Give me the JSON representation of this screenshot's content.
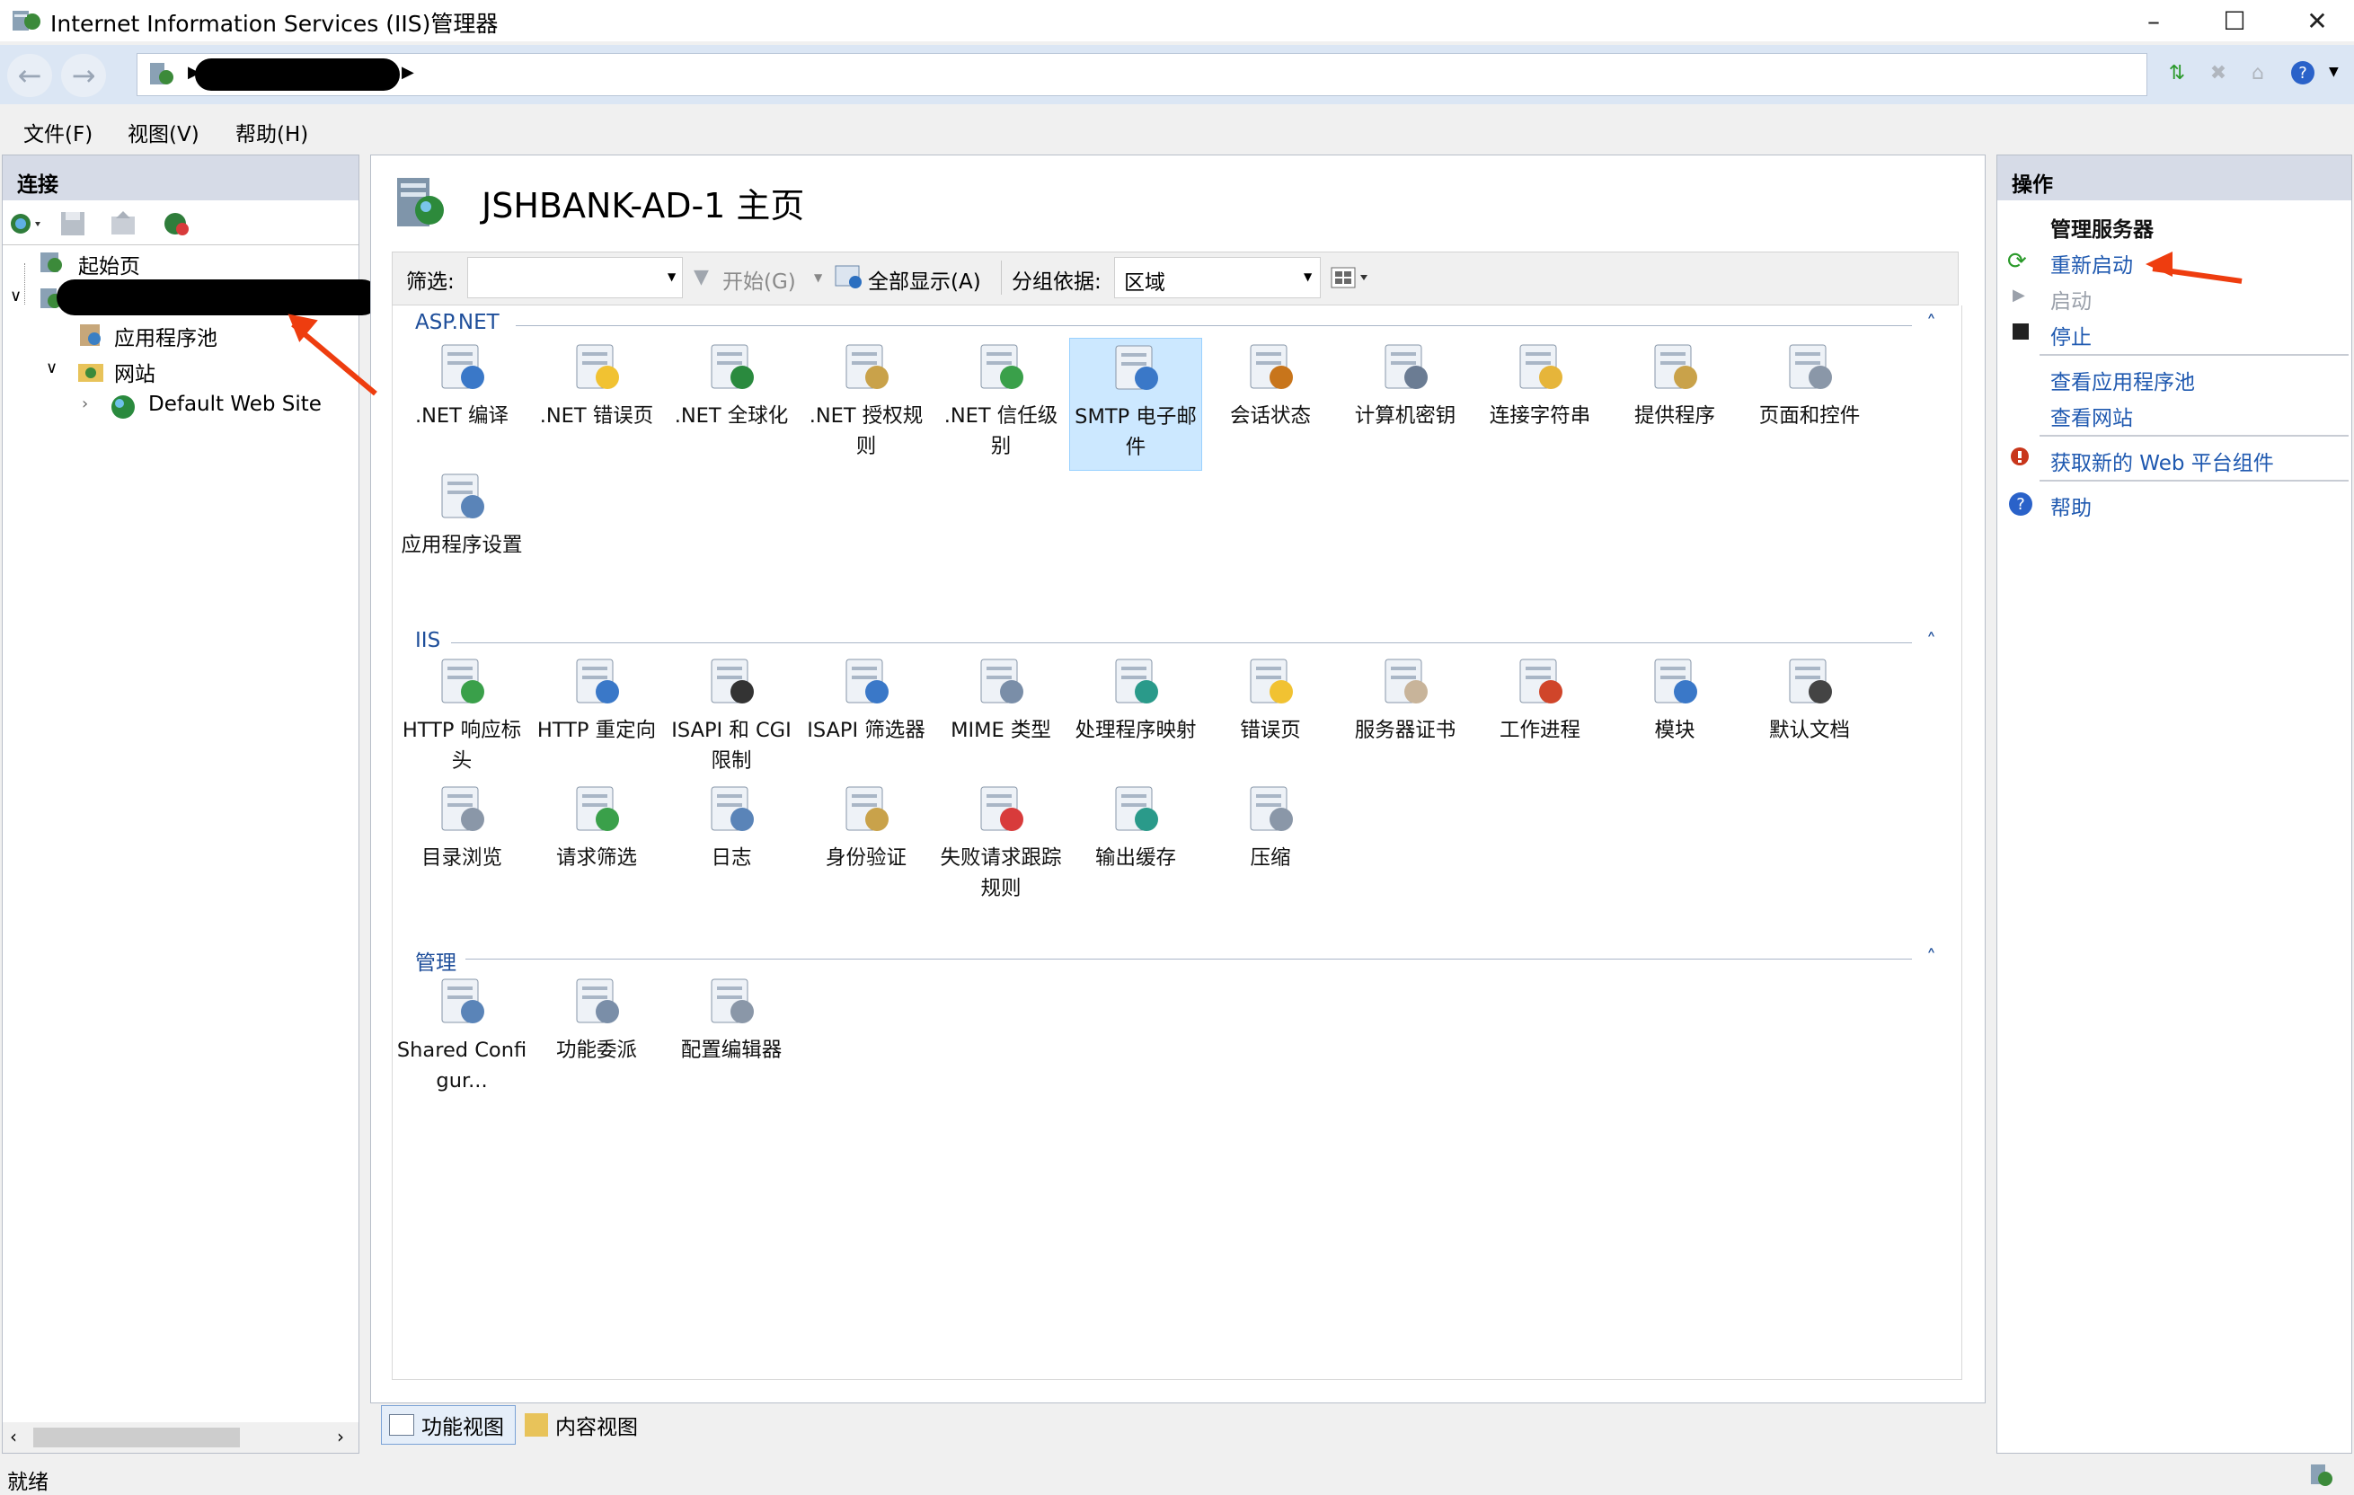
{
  "window": {
    "title": "Internet Information Services (IIS)管理器"
  },
  "menu": [
    "文件(F)",
    "视图(V)",
    "帮助(H)"
  ],
  "connections": {
    "title": "连接",
    "tree": {
      "start_page": "起始页",
      "app_pools": "应用程序池",
      "sites": "网站",
      "default_site": "Default Web Site"
    }
  },
  "main": {
    "page_title": "JSHBANK-AD-1 主页",
    "filter": {
      "label": "筛选:",
      "go": "开始(G)",
      "show_all": "全部显示(A)",
      "group_by_label": "分组依据:",
      "group_by_value": "区域"
    },
    "sections": [
      {
        "title": "ASP.NET",
        "items": [
          {
            "label": ".NET 编译",
            "icon": "net-compile-icon"
          },
          {
            "label": ".NET 错误页",
            "icon": "net-error-pages-icon"
          },
          {
            "label": ".NET 全球化",
            "icon": "net-globalization-icon"
          },
          {
            "label": ".NET 授权规则",
            "icon": "net-authorization-icon"
          },
          {
            "label": ".NET 信任级别",
            "icon": "net-trust-levels-icon"
          },
          {
            "label": "SMTP 电子邮件",
            "icon": "smtp-email-icon",
            "selected": true
          },
          {
            "label": "会话状态",
            "icon": "session-state-icon"
          },
          {
            "label": "计算机密钥",
            "icon": "machine-key-icon"
          },
          {
            "label": "连接字符串",
            "icon": "connection-strings-icon"
          },
          {
            "label": "提供程序",
            "icon": "providers-icon"
          },
          {
            "label": "页面和控件",
            "icon": "pages-controls-icon"
          },
          {
            "label": "应用程序设置",
            "icon": "app-settings-icon"
          }
        ]
      },
      {
        "title": "IIS",
        "items": [
          {
            "label": "HTTP 响应标头",
            "icon": "http-headers-icon"
          },
          {
            "label": "HTTP 重定向",
            "icon": "http-redirect-icon"
          },
          {
            "label": "ISAPI 和 CGI 限制",
            "icon": "isapi-cgi-icon"
          },
          {
            "label": "ISAPI 筛选器",
            "icon": "isapi-filters-icon"
          },
          {
            "label": "MIME 类型",
            "icon": "mime-types-icon"
          },
          {
            "label": "处理程序映射",
            "icon": "handler-mappings-icon"
          },
          {
            "label": "错误页",
            "icon": "error-pages-icon"
          },
          {
            "label": "服务器证书",
            "icon": "server-certificates-icon"
          },
          {
            "label": "工作进程",
            "icon": "worker-processes-icon"
          },
          {
            "label": "模块",
            "icon": "modules-icon"
          },
          {
            "label": "默认文档",
            "icon": "default-document-icon"
          },
          {
            "label": "目录浏览",
            "icon": "directory-browsing-icon"
          },
          {
            "label": "请求筛选",
            "icon": "request-filtering-icon"
          },
          {
            "label": "日志",
            "icon": "logging-icon"
          },
          {
            "label": "身份验证",
            "icon": "authentication-icon"
          },
          {
            "label": "失败请求跟踪规则",
            "icon": "failed-request-tracing-icon"
          },
          {
            "label": "输出缓存",
            "icon": "output-caching-icon"
          },
          {
            "label": "压缩",
            "icon": "compression-icon"
          }
        ]
      },
      {
        "title": "管理",
        "items": [
          {
            "label": "Shared Configur...",
            "icon": "shared-config-icon"
          },
          {
            "label": "功能委派",
            "icon": "feature-delegation-icon"
          },
          {
            "label": "配置编辑器",
            "icon": "config-editor-icon"
          }
        ]
      }
    ],
    "tabs": [
      "功能视图",
      "内容视图"
    ]
  },
  "actions": {
    "title": "操作",
    "manage_server": "管理服务器",
    "restart": "重新启动",
    "start": "启动",
    "stop": "停止",
    "view_app_pools": "查看应用程序池",
    "view_sites": "查看网站",
    "get_components": "获取新的 Web 平台组件",
    "help": "帮助"
  },
  "status": {
    "text": "就绪"
  },
  "colors": {
    "link": "#1f59b0",
    "section": "#1e4e9a",
    "arrow": "#ee3d0f",
    "selected": "#cce8ff"
  }
}
